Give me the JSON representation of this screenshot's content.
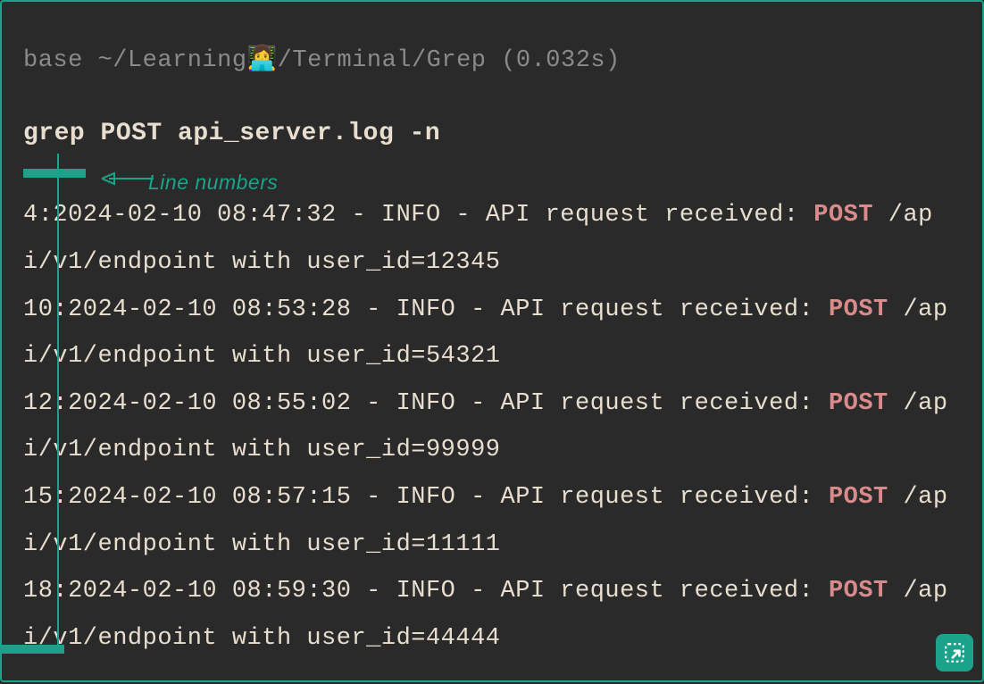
{
  "prompt": {
    "env": "base",
    "path": "~/Learning👩‍💻/Terminal/Grep",
    "timing": "(0.032s)"
  },
  "command": "grep POST api_server.log -n",
  "annotation": {
    "label": "Line numbers"
  },
  "colors": {
    "accent": "#1aa38a",
    "match": "#d98a8a",
    "text": "#e8ded0",
    "muted": "#8a8a8a",
    "bg": "#2a2a2a"
  },
  "output_lines": [
    {
      "lineno": "4",
      "pre": "2024-02-10 08:47:32 - INFO - API request received: ",
      "match": "POST",
      "post": " /api/v1/endpoint with user_id=12345"
    },
    {
      "lineno": "10",
      "pre": "2024-02-10 08:53:28 - INFO - API request received: ",
      "match": "POST",
      "post": " /api/v1/endpoint with user_id=54321"
    },
    {
      "lineno": "12",
      "pre": "2024-02-10 08:55:02 - INFO - API request received: ",
      "match": "POST",
      "post": " /api/v1/endpoint with user_id=99999"
    },
    {
      "lineno": "15",
      "pre": "2024-02-10 08:57:15 - INFO - API request received: ",
      "match": "POST",
      "post": " /api/v1/endpoint with user_id=11111"
    },
    {
      "lineno": "18",
      "pre": "2024-02-10 08:59:30 - INFO - API request received: ",
      "match": "POST",
      "post": " /api/v1/endpoint with user_id=44444"
    }
  ]
}
